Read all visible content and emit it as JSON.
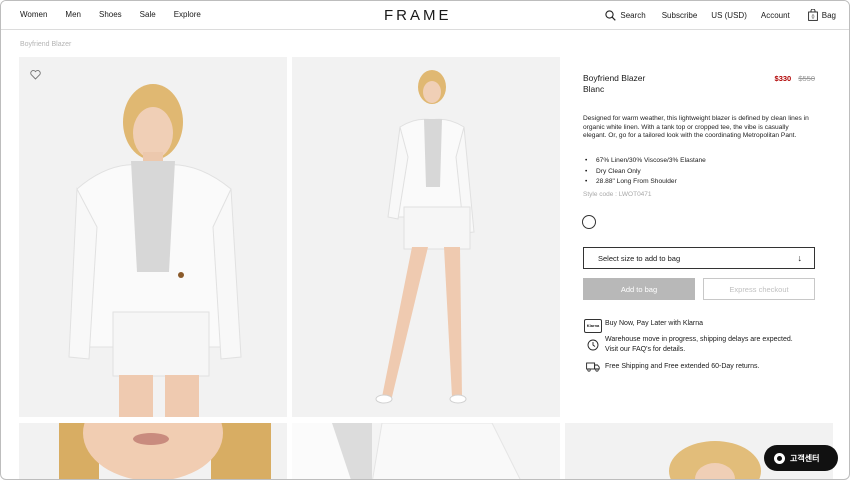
{
  "header": {
    "nav_left": [
      "Women",
      "Men",
      "Shoes",
      "Sale",
      "Explore"
    ],
    "logo": "FRAME",
    "search_label": "Search",
    "subscribe_label": "Subscribe",
    "region_label": "US (USD)",
    "account_label": "Account",
    "bag_label": "Bag",
    "bag_count": "0"
  },
  "breadcrumb": "Boyfriend Blazer",
  "product": {
    "name_line1": "Boyfriend Blazer",
    "name_line2": "Blanc",
    "sale_price": "$330",
    "original_price": "$550",
    "description": "Designed for warm weather, this lightweight blazer is defined by clean lines in organic white linen. With a tank top or cropped tee, the vibe is casually elegant. Or, go for a tailored look with the coordinating Metropolitan Pant.",
    "details": [
      "67% Linen/30% Viscose/3% Elastane",
      "Dry Clean Only",
      "28.88\" Long From Shoulder"
    ],
    "style_code": "Style code : LWOT0471"
  },
  "actions": {
    "size_select": "Select size to add to bag",
    "add_to_bag": "Add to bag",
    "express_checkout": "Express checkout"
  },
  "perks": {
    "klarna_badge": "Klarna",
    "klarna": "Buy Now, Pay Later with Klarna",
    "warehouse_line1": "Warehouse move in progress, shipping delays are expected.",
    "warehouse_line2": "Visit our FAQ's for details.",
    "shipping": "Free Shipping and Free extended 60-Day returns."
  },
  "support_label": "고객센터",
  "colors": {
    "sale": "#b00000",
    "button_disabled": "#b8b8b8",
    "support_bg": "#111111"
  },
  "icons": [
    "search-icon",
    "bag-icon",
    "heart-icon",
    "clock-icon",
    "truck-icon",
    "chevron-down-icon",
    "chat-icon"
  ]
}
